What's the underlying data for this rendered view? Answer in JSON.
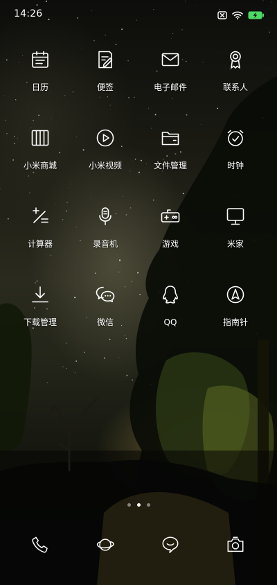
{
  "status_bar": {
    "time": "14:26",
    "icons": [
      "sim-off-icon",
      "wifi-icon",
      "battery-charging-icon"
    ],
    "battery_color": "#4cd964"
  },
  "apps": [
    {
      "label": "日历",
      "icon": "calendar-icon"
    },
    {
      "label": "便签",
      "icon": "notes-icon"
    },
    {
      "label": "电子邮件",
      "icon": "email-icon"
    },
    {
      "label": "联系人",
      "icon": "contacts-icon"
    },
    {
      "label": "小米商城",
      "icon": "mi-store-icon"
    },
    {
      "label": "小米视频",
      "icon": "video-play-icon"
    },
    {
      "label": "文件管理",
      "icon": "file-manager-icon"
    },
    {
      "label": "时钟",
      "icon": "alarm-clock-icon"
    },
    {
      "label": "计算器",
      "icon": "calculator-icon"
    },
    {
      "label": "录音机",
      "icon": "microphone-icon"
    },
    {
      "label": "游戏",
      "icon": "gamepad-icon"
    },
    {
      "label": "米家",
      "icon": "monitor-icon"
    },
    {
      "label": "下载管理",
      "icon": "download-icon"
    },
    {
      "label": "微信",
      "icon": "wechat-icon"
    },
    {
      "label": "QQ",
      "icon": "qq-icon"
    },
    {
      "label": "指南针",
      "icon": "compass-icon"
    }
  ],
  "page_indicator": {
    "pages": 3,
    "current": 2
  },
  "dock": [
    {
      "icon": "phone-icon"
    },
    {
      "icon": "browser-planet-icon"
    },
    {
      "icon": "messages-icon"
    },
    {
      "icon": "camera-icon"
    }
  ]
}
